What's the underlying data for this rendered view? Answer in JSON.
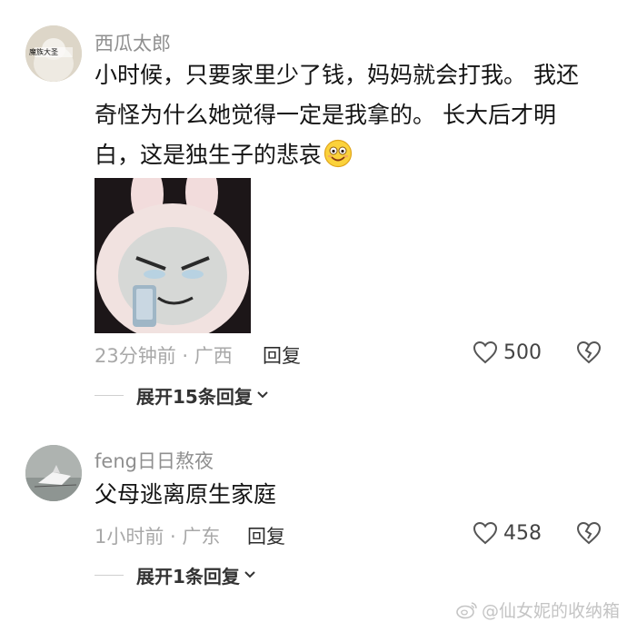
{
  "comments": [
    {
      "username": "西瓜太郎",
      "avatar_text": "魔族大圣",
      "body_lines": [
        "小时候，只要家里少了钱，妈妈就会打我。 我还",
        "奇怪为什么她觉得一定是我拿的。 长大后才明",
        "白，这是独生子的悲哀"
      ],
      "emoji": "smile-emoji",
      "meta": "23分钟前 · 广西",
      "reply_label": "回复",
      "like_count": "500",
      "expand_label": "展开15条回复"
    },
    {
      "username": "feng日日熬夜",
      "body_lines": [
        "父母逃离原生家庭"
      ],
      "meta": "1小时前 · 广东",
      "reply_label": "回复",
      "like_count": "458",
      "expand_label": "展开1条回复"
    }
  ],
  "watermark": "@仙女妮的收纳箱",
  "icons": {
    "like": "heart-outline-icon",
    "dislike": "broken-heart-icon",
    "expand": "chevron-down-icon",
    "watermark": "weibo-logo-icon"
  },
  "colors": {
    "username": "#8f8f8f",
    "body": "#141414",
    "meta": "#a8a8a8"
  }
}
